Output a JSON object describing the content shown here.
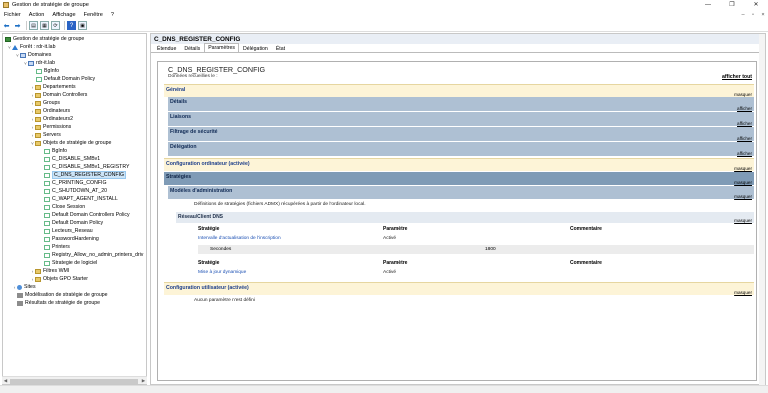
{
  "window": {
    "title": "Gestion de stratégie de groupe",
    "controls": {
      "minimize": "—",
      "maximize": "❐",
      "close": "✕"
    }
  },
  "menu": {
    "items": [
      "Fichier",
      "Action",
      "Affichage",
      "Fenêtre",
      "?"
    ],
    "mdi_controls": [
      "–",
      "▫",
      "×"
    ]
  },
  "toolbar": {
    "buttons": [
      "back-icon",
      "forward-icon",
      "up-icon",
      "properties-icon",
      "refresh-icon",
      "help-icon",
      "console-icon"
    ]
  },
  "tree": {
    "root": "Gestion de stratégie de groupe",
    "forest": "Forêt : rdr-it.lab",
    "domains": "Domaines",
    "domain": "rdr-it.lab",
    "items": [
      "BgInfo",
      "Default Domain Policy",
      "Departements",
      "Domain Controllers",
      "Groups",
      "Ordinateurs",
      "Ordinateurs2",
      "Permissions",
      "Servers",
      "Objets de stratégie de groupe"
    ],
    "gpos": [
      "BgInfo",
      "C_DISABLE_SMBv1",
      "C_DISABLE_SMBv1_REGISTRY",
      "C_DNS_REGISTER_CONFIG",
      "C_PRINTING_CONFIG",
      "C_SHUTDOWN_AT_20",
      "C_WAPT_AGENT_INSTALL",
      "Close Session",
      "Default Domain Controllers Policy",
      "Default Domain Policy",
      "Lecteurs_Reseau",
      "PasswordHardening",
      "Printers",
      "Registry_Allow_no_admin_printers_driv",
      "Strategie de logiciel"
    ],
    "wmi": "Filtres WMI",
    "starter": "Objets GPO Starter",
    "sites": "Sites",
    "modeling": "Modélisation de stratégie de groupe",
    "results": "Résultats de stratégie de groupe"
  },
  "right": {
    "header": "C_DNS_REGISTER_CONFIG",
    "tabs": [
      "Étendue",
      "Détails",
      "Paramètres",
      "Délégation",
      "État"
    ],
    "active_tab": "Paramètres"
  },
  "report": {
    "title": "C_DNS_REGISTER_CONFIG",
    "subtitle": "Données recueillies le :",
    "show_all": "afficher tout",
    "general": {
      "label": "Général",
      "action": "masquer"
    },
    "details": {
      "label": "Détails",
      "action": "afficher"
    },
    "links": {
      "label": "Liaisons",
      "action": "afficher"
    },
    "security": {
      "label": "Filtrage de sécurité",
      "action": "afficher"
    },
    "delegation": {
      "label": "Délégation",
      "action": "afficher"
    },
    "computer": {
      "label": "Configuration ordinateur (activée)",
      "action": "masquer"
    },
    "policies": {
      "label": "Stratégies",
      "action": "masquer"
    },
    "admin_templates": {
      "label": "Modèles d'administration",
      "action": "masquer"
    },
    "admin_note": "Définitions de stratégies (fichiers ADMX) récupérées à partir de l'ordinateur local.",
    "dns_client": {
      "label": "Réseau/Client DNS",
      "action": "masquer"
    },
    "table1": {
      "headers": [
        "Stratégie",
        "Paramètre",
        "Commentaire"
      ],
      "row": [
        "Intervalle d'actualisation de l'inscription",
        "Activé",
        ""
      ],
      "sub": [
        "Secondes",
        "1800"
      ]
    },
    "table2": {
      "headers": [
        "Stratégie",
        "Paramètre",
        "Commentaire"
      ],
      "row": [
        "Mise à jour dynamique",
        "Activé",
        ""
      ]
    },
    "user": {
      "label": "Configuration utilisateur (activée)",
      "action": "masquer"
    },
    "user_note": "Aucun paramètre n'est défini"
  }
}
